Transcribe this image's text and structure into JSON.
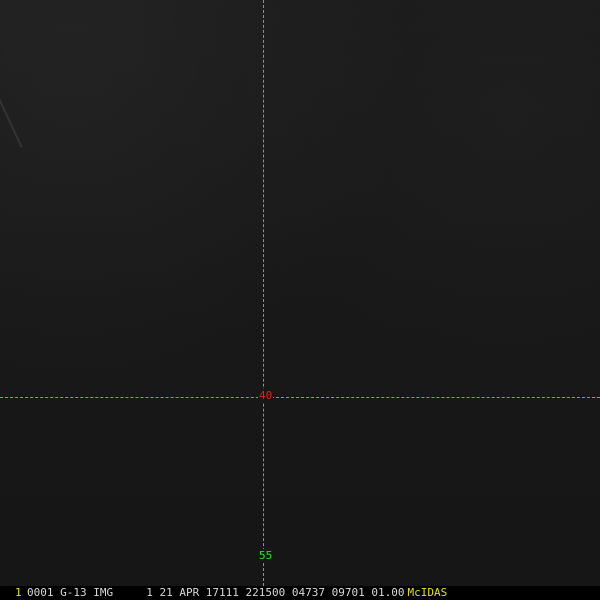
{
  "image": {
    "latitude_label": "40",
    "longitude_label": "55",
    "colors": {
      "background": "#171717",
      "grid_line": "#2fb7c4",
      "latitude_label": "#e02020",
      "longitude_label": "#2ee02e",
      "status_accent": "#e0e020"
    }
  },
  "status_bar": {
    "frame_number": "1",
    "header": "0001 G-13 IMG     1 21 APR 17111 221500 04737 09701 01.00",
    "brand": "McIDAS"
  }
}
